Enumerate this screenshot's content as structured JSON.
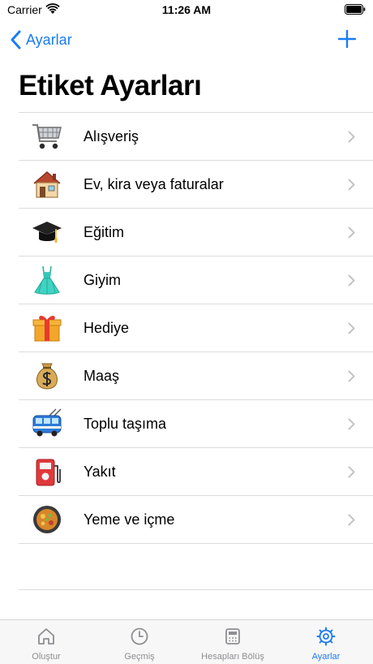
{
  "status": {
    "carrier": "Carrier",
    "time": "11:26 AM"
  },
  "nav": {
    "back_label": "Ayarlar",
    "add_icon": "plus-icon"
  },
  "title": "Etiket Ayarları",
  "tags": [
    {
      "label": "Alışveriş",
      "emoji": "🛒",
      "icon": "shopping-cart-icon"
    },
    {
      "label": "Ev, kira veya faturalar",
      "emoji": "🏠",
      "icon": "house-icon"
    },
    {
      "label": "Eğitim",
      "emoji": "🎓",
      "icon": "graduation-cap-icon"
    },
    {
      "label": "Giyim",
      "emoji": "👗",
      "icon": "dress-icon"
    },
    {
      "label": "Hediye",
      "emoji": "🎁",
      "icon": "gift-icon"
    },
    {
      "label": "Maaş",
      "emoji": "💰",
      "icon": "money-bag-icon"
    },
    {
      "label": "Toplu taşıma",
      "emoji": "🚎",
      "icon": "trolleybus-icon"
    },
    {
      "label": "Yakıt",
      "emoji": "⛽",
      "icon": "fuel-pump-icon"
    },
    {
      "label": "Yeme ve içme",
      "emoji": "🥘",
      "icon": "food-pan-icon"
    }
  ],
  "tabs": [
    {
      "label": "Oluştur",
      "icon": "house-icon",
      "active": false
    },
    {
      "label": "Geçmiş",
      "icon": "clock-icon",
      "active": false
    },
    {
      "label": "Hesapları Bölüş",
      "icon": "register-icon",
      "active": false
    },
    {
      "label": "Ayarlar",
      "icon": "gear-icon",
      "active": true
    }
  ],
  "colors": {
    "accent": "#1a7cf5",
    "inactive": "#8e8e93",
    "separator": "#dcdcdc"
  }
}
